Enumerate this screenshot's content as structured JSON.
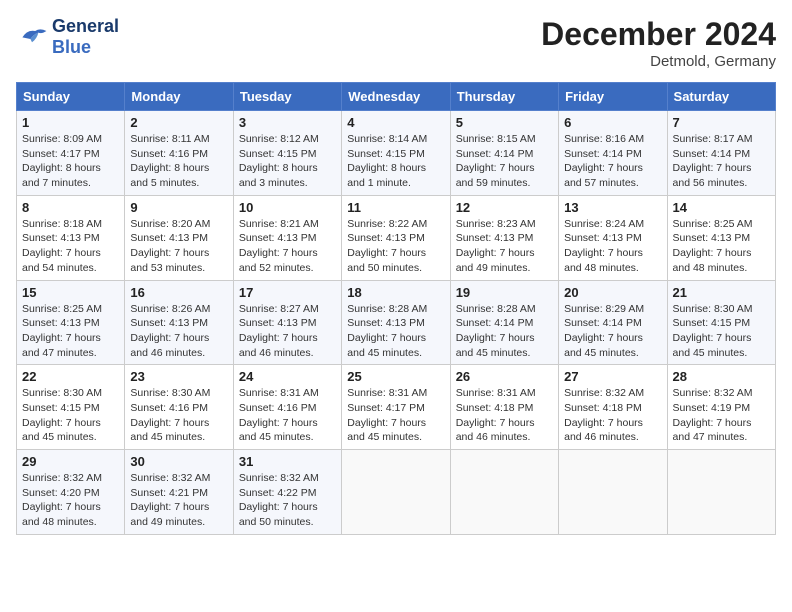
{
  "header": {
    "logo_line1": "General",
    "logo_line2": "Blue",
    "month": "December 2024",
    "location": "Detmold, Germany"
  },
  "weekdays": [
    "Sunday",
    "Monday",
    "Tuesday",
    "Wednesday",
    "Thursday",
    "Friday",
    "Saturday"
  ],
  "weeks": [
    [
      {
        "day": "1",
        "info": "Sunrise: 8:09 AM\nSunset: 4:17 PM\nDaylight: 8 hours\nand 7 minutes."
      },
      {
        "day": "2",
        "info": "Sunrise: 8:11 AM\nSunset: 4:16 PM\nDaylight: 8 hours\nand 5 minutes."
      },
      {
        "day": "3",
        "info": "Sunrise: 8:12 AM\nSunset: 4:15 PM\nDaylight: 8 hours\nand 3 minutes."
      },
      {
        "day": "4",
        "info": "Sunrise: 8:14 AM\nSunset: 4:15 PM\nDaylight: 8 hours\nand 1 minute."
      },
      {
        "day": "5",
        "info": "Sunrise: 8:15 AM\nSunset: 4:14 PM\nDaylight: 7 hours\nand 59 minutes."
      },
      {
        "day": "6",
        "info": "Sunrise: 8:16 AM\nSunset: 4:14 PM\nDaylight: 7 hours\nand 57 minutes."
      },
      {
        "day": "7",
        "info": "Sunrise: 8:17 AM\nSunset: 4:14 PM\nDaylight: 7 hours\nand 56 minutes."
      }
    ],
    [
      {
        "day": "8",
        "info": "Sunrise: 8:18 AM\nSunset: 4:13 PM\nDaylight: 7 hours\nand 54 minutes."
      },
      {
        "day": "9",
        "info": "Sunrise: 8:20 AM\nSunset: 4:13 PM\nDaylight: 7 hours\nand 53 minutes."
      },
      {
        "day": "10",
        "info": "Sunrise: 8:21 AM\nSunset: 4:13 PM\nDaylight: 7 hours\nand 52 minutes."
      },
      {
        "day": "11",
        "info": "Sunrise: 8:22 AM\nSunset: 4:13 PM\nDaylight: 7 hours\nand 50 minutes."
      },
      {
        "day": "12",
        "info": "Sunrise: 8:23 AM\nSunset: 4:13 PM\nDaylight: 7 hours\nand 49 minutes."
      },
      {
        "day": "13",
        "info": "Sunrise: 8:24 AM\nSunset: 4:13 PM\nDaylight: 7 hours\nand 48 minutes."
      },
      {
        "day": "14",
        "info": "Sunrise: 8:25 AM\nSunset: 4:13 PM\nDaylight: 7 hours\nand 48 minutes."
      }
    ],
    [
      {
        "day": "15",
        "info": "Sunrise: 8:25 AM\nSunset: 4:13 PM\nDaylight: 7 hours\nand 47 minutes."
      },
      {
        "day": "16",
        "info": "Sunrise: 8:26 AM\nSunset: 4:13 PM\nDaylight: 7 hours\nand 46 minutes."
      },
      {
        "day": "17",
        "info": "Sunrise: 8:27 AM\nSunset: 4:13 PM\nDaylight: 7 hours\nand 46 minutes."
      },
      {
        "day": "18",
        "info": "Sunrise: 8:28 AM\nSunset: 4:13 PM\nDaylight: 7 hours\nand 45 minutes."
      },
      {
        "day": "19",
        "info": "Sunrise: 8:28 AM\nSunset: 4:14 PM\nDaylight: 7 hours\nand 45 minutes."
      },
      {
        "day": "20",
        "info": "Sunrise: 8:29 AM\nSunset: 4:14 PM\nDaylight: 7 hours\nand 45 minutes."
      },
      {
        "day": "21",
        "info": "Sunrise: 8:30 AM\nSunset: 4:15 PM\nDaylight: 7 hours\nand 45 minutes."
      }
    ],
    [
      {
        "day": "22",
        "info": "Sunrise: 8:30 AM\nSunset: 4:15 PM\nDaylight: 7 hours\nand 45 minutes."
      },
      {
        "day": "23",
        "info": "Sunrise: 8:30 AM\nSunset: 4:16 PM\nDaylight: 7 hours\nand 45 minutes."
      },
      {
        "day": "24",
        "info": "Sunrise: 8:31 AM\nSunset: 4:16 PM\nDaylight: 7 hours\nand 45 minutes."
      },
      {
        "day": "25",
        "info": "Sunrise: 8:31 AM\nSunset: 4:17 PM\nDaylight: 7 hours\nand 45 minutes."
      },
      {
        "day": "26",
        "info": "Sunrise: 8:31 AM\nSunset: 4:18 PM\nDaylight: 7 hours\nand 46 minutes."
      },
      {
        "day": "27",
        "info": "Sunrise: 8:32 AM\nSunset: 4:18 PM\nDaylight: 7 hours\nand 46 minutes."
      },
      {
        "day": "28",
        "info": "Sunrise: 8:32 AM\nSunset: 4:19 PM\nDaylight: 7 hours\nand 47 minutes."
      }
    ],
    [
      {
        "day": "29",
        "info": "Sunrise: 8:32 AM\nSunset: 4:20 PM\nDaylight: 7 hours\nand 48 minutes."
      },
      {
        "day": "30",
        "info": "Sunrise: 8:32 AM\nSunset: 4:21 PM\nDaylight: 7 hours\nand 49 minutes."
      },
      {
        "day": "31",
        "info": "Sunrise: 8:32 AM\nSunset: 4:22 PM\nDaylight: 7 hours\nand 50 minutes."
      },
      {
        "day": "",
        "info": ""
      },
      {
        "day": "",
        "info": ""
      },
      {
        "day": "",
        "info": ""
      },
      {
        "day": "",
        "info": ""
      }
    ]
  ]
}
